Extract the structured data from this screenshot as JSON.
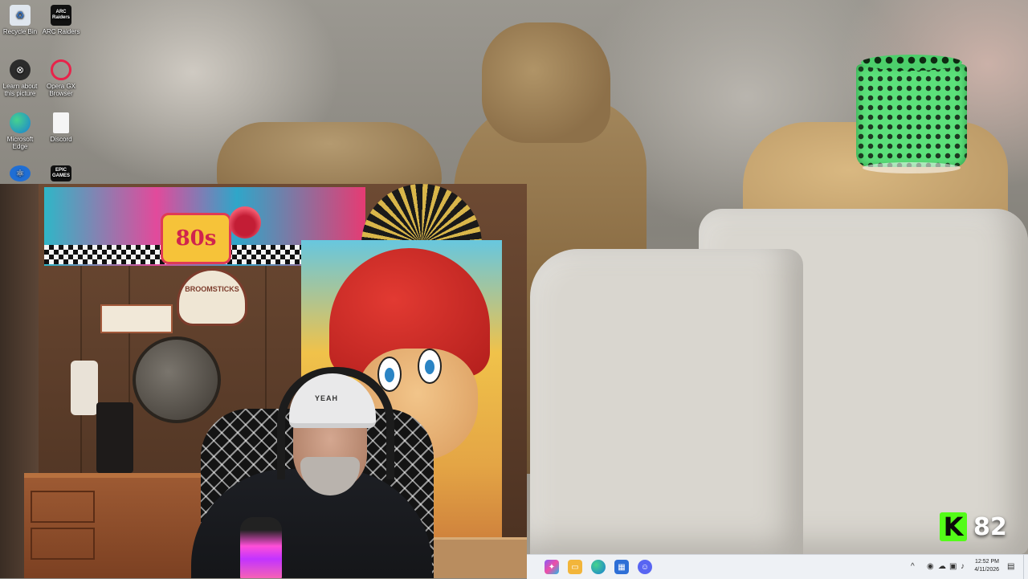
{
  "desktop": {
    "icons": [
      {
        "label": "Recycle Bin",
        "icon": "recycle-bin-icon"
      },
      {
        "label": "ARC Raiders",
        "icon": "arc-raiders-icon",
        "badge": "ARC Raiders"
      },
      {
        "label": "Learn about this picture",
        "icon": "camera-icon"
      },
      {
        "label": "Opera GX Browser",
        "icon": "opera-gx-icon"
      },
      {
        "label": "Microsoft Edge",
        "icon": "edge-icon"
      },
      {
        "label": "Discord",
        "icon": "document-icon"
      },
      {
        "label": "",
        "icon": "atom-icon"
      },
      {
        "label": "",
        "icon": "epic-games-icon",
        "badge": "EPIC GAMES"
      }
    ]
  },
  "webcam": {
    "sign_80s": "80s",
    "shelf_sign": "BROOMSTICKS",
    "cap_text": "YEAH"
  },
  "overlay": {
    "kick_logo": "K",
    "viewer_count": "82",
    "brand_color": "#53fc18"
  },
  "taskbar": {
    "apps": [
      {
        "icon": "copilot-icon",
        "color": "#8a5cf6"
      },
      {
        "icon": "file-explorer-icon",
        "color": "#f2b53a"
      },
      {
        "icon": "edge-icon",
        "color": "#1c9ad6"
      },
      {
        "icon": "store-icon",
        "color": "#2e6fd6"
      },
      {
        "icon": "discord-icon",
        "color": "#5865f2"
      }
    ],
    "tray_chevron": "^",
    "time": "12:52 PM",
    "date": "4/11/2026"
  }
}
